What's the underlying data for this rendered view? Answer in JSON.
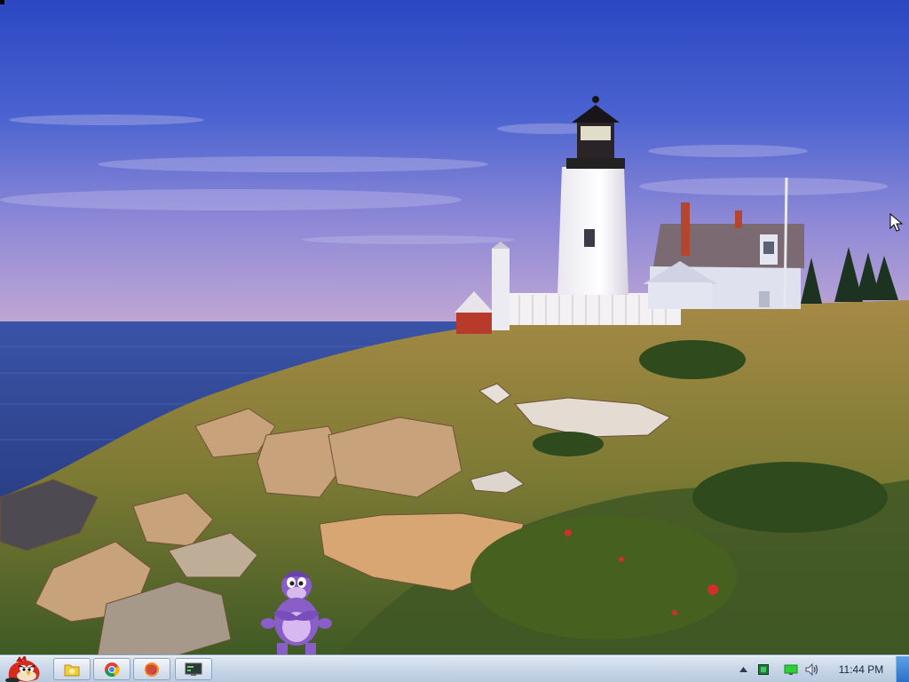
{
  "desktop": {
    "wallpaper_icon": "lighthouse-landscape-wallpaper",
    "assistant_icon": "purple-gorilla-assistant"
  },
  "taskbar": {
    "start_icon": "angry-bird-start-orb",
    "pinned": [
      {
        "name": "file-explorer",
        "icon": "folder-icon"
      },
      {
        "name": "chrome",
        "icon": "chrome-icon"
      },
      {
        "name": "firefox",
        "icon": "firefox-icon"
      },
      {
        "name": "terminal",
        "icon": "terminal-icon"
      }
    ],
    "tray": {
      "show_hidden_icon": "chevron-up-icon",
      "icons": [
        "app-tray-icon",
        "network-icon",
        "volume-icon"
      ],
      "clock": "11:44 PM"
    }
  },
  "colors": {
    "sky_top": "#2f4fc8",
    "sky_bottom": "#b9a7d6",
    "sea": "#2a3f8c",
    "grass": "#8a7a35",
    "taskbar": "#c9d7e8",
    "accent_red": "#c62828"
  }
}
